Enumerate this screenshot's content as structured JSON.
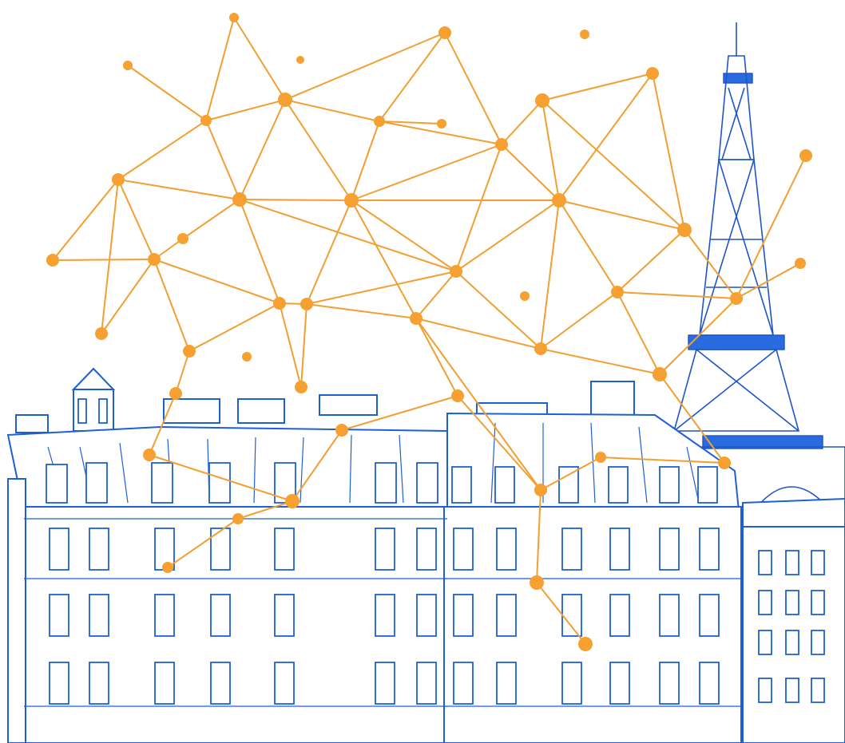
{
  "scene": {
    "description_alt": "",
    "colors": {
      "sky": "#ffffff",
      "line_art": "#1f5fd6",
      "network": "#f5a030"
    },
    "network_nodes": [
      [
        293,
        22,
        6
      ],
      [
        160,
        82,
        6
      ],
      [
        376,
        75,
        5
      ],
      [
        557,
        41,
        8
      ],
      [
        732,
        43,
        6
      ],
      [
        357,
        125,
        9
      ],
      [
        258,
        151,
        7
      ],
      [
        475,
        152,
        7
      ],
      [
        553,
        155,
        6
      ],
      [
        679,
        126,
        9
      ],
      [
        817,
        92,
        8
      ],
      [
        628,
        181,
        8
      ],
      [
        1009,
        195,
        8
      ],
      [
        148,
        225,
        8
      ],
      [
        300,
        250,
        9
      ],
      [
        440,
        251,
        9
      ],
      [
        700,
        251,
        9
      ],
      [
        229,
        299,
        7
      ],
      [
        857,
        288,
        9
      ],
      [
        1002,
        330,
        7
      ],
      [
        66,
        326,
        8
      ],
      [
        193,
        325,
        8
      ],
      [
        571,
        340,
        8
      ],
      [
        657,
        371,
        6
      ],
      [
        773,
        366,
        8
      ],
      [
        350,
        380,
        8
      ],
      [
        384,
        381,
        8
      ],
      [
        922,
        374,
        8
      ],
      [
        127,
        418,
        8
      ],
      [
        237,
        440,
        8
      ],
      [
        309,
        447,
        6
      ],
      [
        521,
        399,
        8
      ],
      [
        677,
        437,
        8
      ],
      [
        826,
        469,
        9
      ],
      [
        377,
        485,
        8
      ],
      [
        220,
        493,
        8
      ],
      [
        573,
        496,
        8
      ],
      [
        428,
        539,
        8
      ],
      [
        187,
        570,
        8
      ],
      [
        752,
        573,
        7
      ],
      [
        907,
        580,
        8
      ],
      [
        677,
        614,
        8
      ],
      [
        366,
        628,
        9
      ],
      [
        298,
        650,
        7
      ],
      [
        210,
        711,
        7
      ],
      [
        672,
        730,
        9
      ],
      [
        733,
        807,
        9
      ]
    ],
    "network_edges": [
      [
        0,
        5
      ],
      [
        0,
        6
      ],
      [
        1,
        6
      ],
      [
        3,
        5
      ],
      [
        3,
        7
      ],
      [
        3,
        11
      ],
      [
        5,
        6
      ],
      [
        5,
        7
      ],
      [
        5,
        14
      ],
      [
        5,
        15
      ],
      [
        6,
        13
      ],
      [
        6,
        14
      ],
      [
        7,
        11
      ],
      [
        7,
        15
      ],
      [
        9,
        10
      ],
      [
        9,
        11
      ],
      [
        9,
        16
      ],
      [
        9,
        18
      ],
      [
        10,
        16
      ],
      [
        10,
        18
      ],
      [
        11,
        15
      ],
      [
        11,
        16
      ],
      [
        11,
        22
      ],
      [
        13,
        14
      ],
      [
        13,
        21
      ],
      [
        14,
        15
      ],
      [
        14,
        17
      ],
      [
        14,
        25
      ],
      [
        14,
        22
      ],
      [
        15,
        16
      ],
      [
        15,
        22
      ],
      [
        15,
        26
      ],
      [
        15,
        31
      ],
      [
        16,
        18
      ],
      [
        16,
        22
      ],
      [
        16,
        24
      ],
      [
        16,
        32
      ],
      [
        17,
        21
      ],
      [
        18,
        24
      ],
      [
        18,
        27
      ],
      [
        20,
        21
      ],
      [
        20,
        13
      ],
      [
        21,
        25
      ],
      [
        21,
        28
      ],
      [
        21,
        29
      ],
      [
        22,
        26
      ],
      [
        22,
        31
      ],
      [
        22,
        32
      ],
      [
        24,
        27
      ],
      [
        24,
        33
      ],
      [
        24,
        32
      ],
      [
        26,
        25
      ],
      [
        26,
        31
      ],
      [
        26,
        34
      ],
      [
        25,
        34
      ],
      [
        29,
        35
      ],
      [
        31,
        32
      ],
      [
        31,
        36
      ],
      [
        32,
        33
      ],
      [
        31,
        41
      ],
      [
        33,
        40
      ],
      [
        36,
        37
      ],
      [
        37,
        42
      ],
      [
        42,
        43
      ],
      [
        43,
        44
      ],
      [
        35,
        38
      ],
      [
        38,
        42
      ],
      [
        41,
        39
      ],
      [
        39,
        40
      ],
      [
        45,
        46
      ],
      [
        45,
        41
      ],
      [
        12,
        27
      ],
      [
        19,
        27
      ],
      [
        27,
        33
      ],
      [
        13,
        28
      ],
      [
        29,
        25
      ],
      [
        36,
        41
      ],
      [
        8,
        7
      ]
    ]
  }
}
